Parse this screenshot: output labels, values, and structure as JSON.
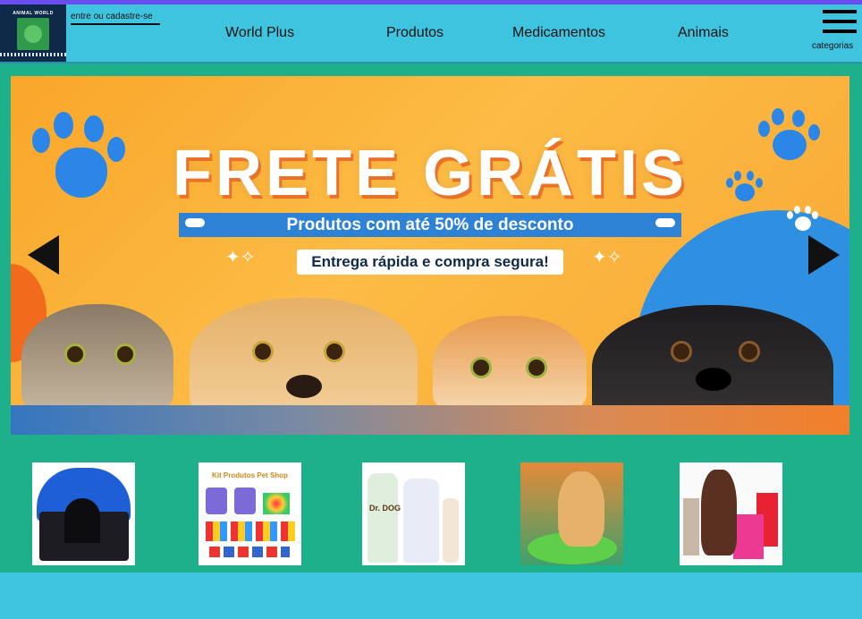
{
  "header": {
    "logo_title": "ANIMAL WORLD",
    "login_link": "entre ou cadastre-se",
    "nav": [
      "World Plus",
      "Produtos",
      "Medicamentos",
      "Animais"
    ],
    "menu_label": "categorias"
  },
  "banner": {
    "title": "FRETE GRÁTIS",
    "subtitle": "Produtos com até 50% de desconto",
    "tagline": "Entrega rápida e compra segura!"
  },
  "products": [
    {
      "name": "Casinha plástica azul"
    },
    {
      "name": "Kit Produtos Pet Shop",
      "label": "Kit Produtos Pet Shop"
    },
    {
      "name": "Dr. Dog shampoo",
      "label": "Dr. DOG"
    },
    {
      "name": "Cachorro na cama verde"
    },
    {
      "name": "Cachorro com sacolas"
    }
  ],
  "colors": {
    "page_bg": "#1eb08a",
    "header_bg": "#3fc4e0",
    "accent_top": "#6a4cf0"
  }
}
